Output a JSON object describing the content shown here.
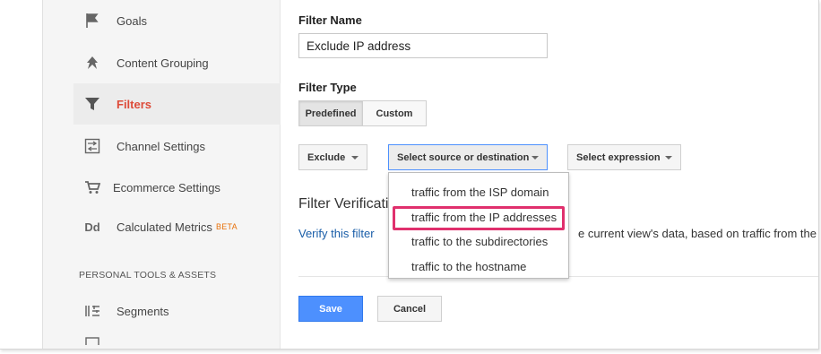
{
  "sidebar": {
    "items": [
      {
        "label": "Goals",
        "icon": "flag-icon"
      },
      {
        "label": "Content Grouping",
        "icon": "content-grouping-icon"
      },
      {
        "label": "Filters",
        "icon": "filter-icon",
        "active": true
      },
      {
        "label": "Channel Settings",
        "icon": "channel-settings-icon"
      },
      {
        "label": "Ecommerce Settings",
        "icon": "cart-icon"
      },
      {
        "label": "Calculated Metrics",
        "icon": "dd-icon",
        "badge": "BETA"
      }
    ],
    "dd_glyph": "Dd",
    "section_heading": "PERSONAL TOOLS & ASSETS",
    "section_items": [
      {
        "label": "Segments",
        "icon": "segments-icon"
      }
    ]
  },
  "form": {
    "filter_name_label": "Filter Name",
    "filter_name_value": "Exclude IP address",
    "filter_type_label": "Filter Type",
    "type_buttons": {
      "predefined": "Predefined",
      "custom": "Custom"
    },
    "dropdowns": {
      "action": "Exclude",
      "source": "Select source or destination",
      "expression": "Select expression"
    },
    "menu_options": [
      "traffic from the ISP domain",
      "traffic from the IP addresses",
      "traffic to the subdirectories",
      "traffic to the hostname"
    ],
    "verification_title": "Filter Verification",
    "verify_link": "Verify this filter",
    "verify_desc": "e current view's data, based on traffic from the",
    "save_label": "Save",
    "cancel_label": "Cancel"
  },
  "colors": {
    "active_nav": "#dd4b39",
    "primary_button": "#4d90fe",
    "highlight_box": "#e0306d",
    "link": "#1a5ea8",
    "beta": "#e8710a"
  }
}
